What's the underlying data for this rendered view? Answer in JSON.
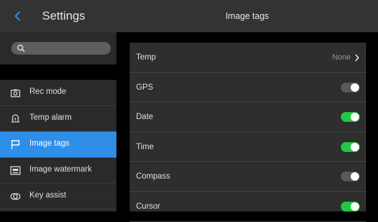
{
  "sidebar": {
    "title": "Settings",
    "search": {
      "placeholder": ""
    },
    "items": [
      {
        "label": "Rec mode",
        "icon": "camera-icon",
        "active": false
      },
      {
        "label": "Temp alarm",
        "icon": "alarm-icon",
        "active": false
      },
      {
        "label": "Image tags",
        "icon": "flag-icon",
        "active": true
      },
      {
        "label": "Image watermark",
        "icon": "watermark-icon",
        "active": false
      },
      {
        "label": "Key assist",
        "icon": "key-assist-icon",
        "active": false
      }
    ]
  },
  "main": {
    "title": "Image tags",
    "rows": [
      {
        "label": "Temp",
        "value": "None",
        "type": "link"
      },
      {
        "label": "GPS",
        "type": "toggle",
        "on": false
      },
      {
        "label": "Date",
        "type": "toggle",
        "on": true
      },
      {
        "label": "Time",
        "type": "toggle",
        "on": true
      },
      {
        "label": "Compass",
        "type": "toggle",
        "on": false
      },
      {
        "label": "Cursor",
        "type": "toggle",
        "on": true
      }
    ]
  },
  "colors": {
    "accent": "#2f8fe8",
    "toggle_on": "#22c743",
    "toggle_off": "#5a5a5a"
  }
}
